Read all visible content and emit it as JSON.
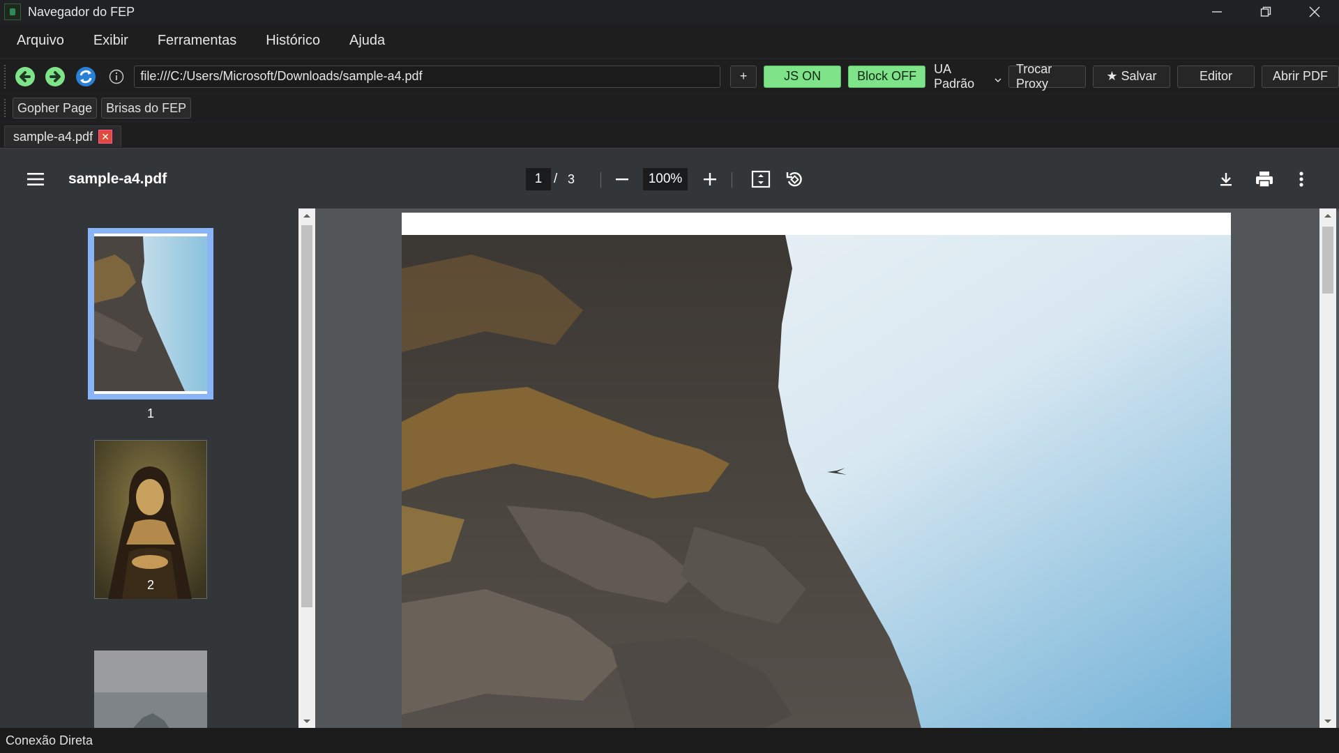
{
  "window": {
    "title": "Navegador do FEP"
  },
  "menu": [
    "Arquivo",
    "Exibir",
    "Ferramentas",
    "Histórico",
    "Ajuda"
  ],
  "nav": {
    "url": "file:///C:/Users/Microsoft/Downloads/sample-a4.pdf",
    "new_tab": "+",
    "js": "JS ON",
    "block": "Block OFF",
    "ua": "UA Padrão",
    "proxy": "Trocar Proxy",
    "save": "★ Salvar",
    "editor": "Editor",
    "open_pdf": "Abrir PDF"
  },
  "bookmarks": [
    "Gopher Page",
    "Brisas do FEP"
  ],
  "tab": {
    "label": "sample-a4.pdf",
    "close": "✕"
  },
  "pdf": {
    "title": "sample-a4.pdf",
    "page": "1",
    "separator": "/",
    "total": "3",
    "zoom": "100%",
    "thumbs": [
      {
        "num": "1"
      },
      {
        "num": "2"
      }
    ]
  },
  "status": "Conexão Direta",
  "colors": {
    "accent_green": "#7fe38a",
    "viewer_bg": "#525659",
    "toolbar_bg": "#323639",
    "thumb_select": "#8ab4f8"
  }
}
